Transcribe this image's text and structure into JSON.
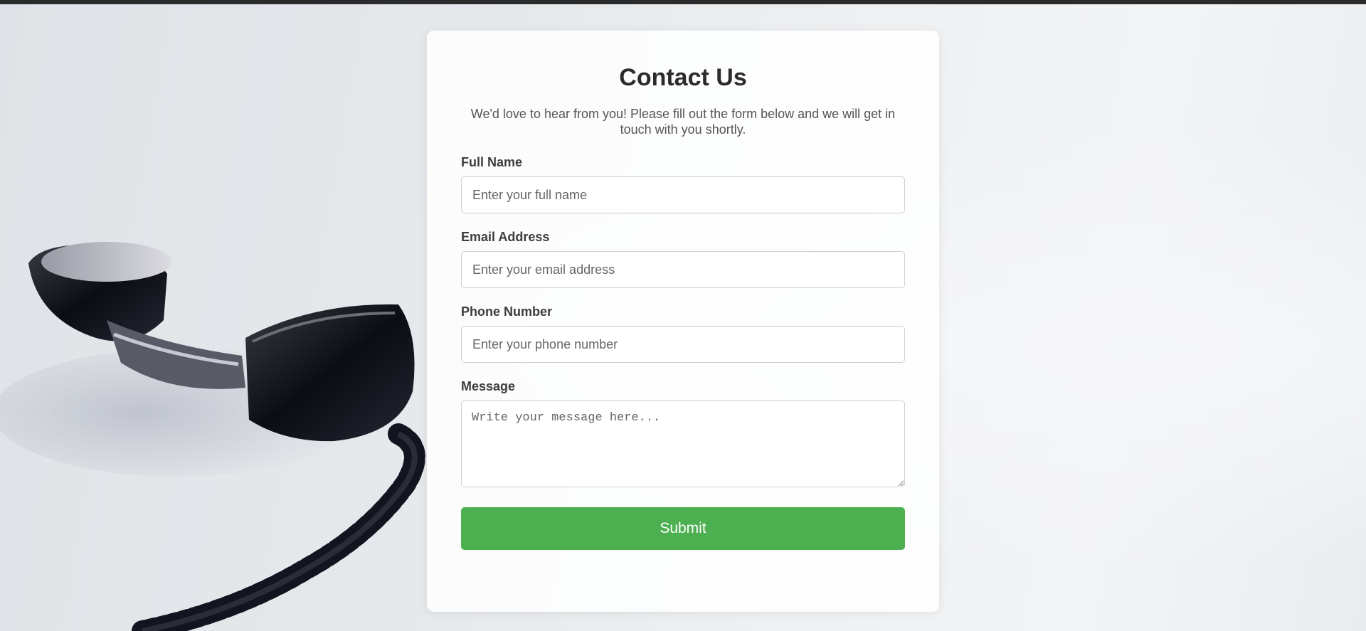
{
  "colors": {
    "accent": "#4caf50",
    "top_strip": "#2b2b2b",
    "card_background": "#ffffff"
  },
  "form": {
    "title": "Contact Us",
    "intro": "We'd love to hear from you! Please fill out the form below and we will get in touch with you shortly.",
    "fields": [
      {
        "label": "Full Name",
        "placeholder": "Enter your full name",
        "value": ""
      },
      {
        "label": "Email Address",
        "placeholder": "Enter your email address",
        "value": ""
      },
      {
        "label": "Phone Number",
        "placeholder": "Enter your phone number",
        "value": ""
      }
    ],
    "message": {
      "label": "Message",
      "placeholder": "Write your message here...",
      "value": ""
    },
    "submit_label": "Submit"
  },
  "background": {
    "image_icon": "telephone-handset-icon"
  }
}
